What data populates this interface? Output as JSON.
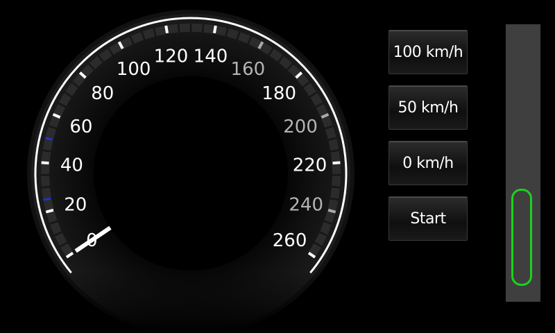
{
  "gauge": {
    "speed_value": 0,
    "unit": "km/h",
    "labels_major": [
      "0",
      "20",
      "40",
      "60",
      "80",
      "100",
      "120",
      "140",
      "180",
      "220",
      "260"
    ],
    "labels_minor": [
      "160",
      "200",
      "240"
    ],
    "tick_values": [
      0,
      20,
      40,
      60,
      80,
      100,
      120,
      140,
      160,
      180,
      200,
      220,
      240,
      260
    ],
    "blue_tick_values": [
      25,
      50
    ],
    "colors": {
      "major_label": "#ffffff",
      "minor_label": "#b4b4b4",
      "needle": "#ffffff",
      "marker": "#2233cc",
      "ring": "#ffffff"
    }
  },
  "buttons": [
    {
      "label": "100 km/h"
    },
    {
      "label": "50 km/h"
    },
    {
      "label": "0 km/h"
    },
    {
      "label": "Start"
    }
  ],
  "slider": {
    "value": 0,
    "accent_color": "#1cd21c"
  }
}
